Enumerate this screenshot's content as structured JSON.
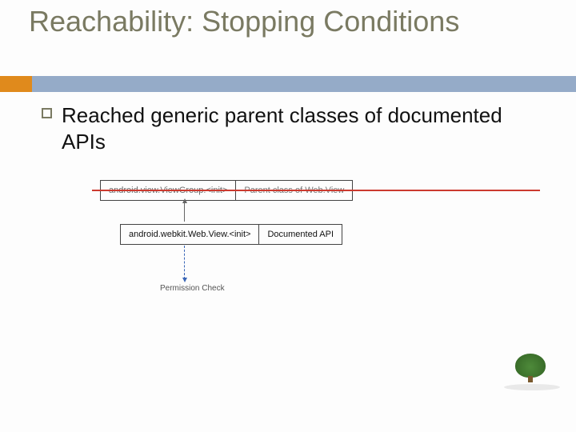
{
  "title": "Reachability: Stopping Conditions",
  "bullet": "Reached generic parent classes of documented APIs",
  "diagram": {
    "parent_api": "android.view.ViewGroup.<init>",
    "parent_label": "Parent class of Web.View",
    "child_api": "android.webkit.Web.View.<init>",
    "child_label": "Documented API",
    "permission": "Permission Check"
  },
  "icons": {
    "tree": "tree-icon"
  }
}
